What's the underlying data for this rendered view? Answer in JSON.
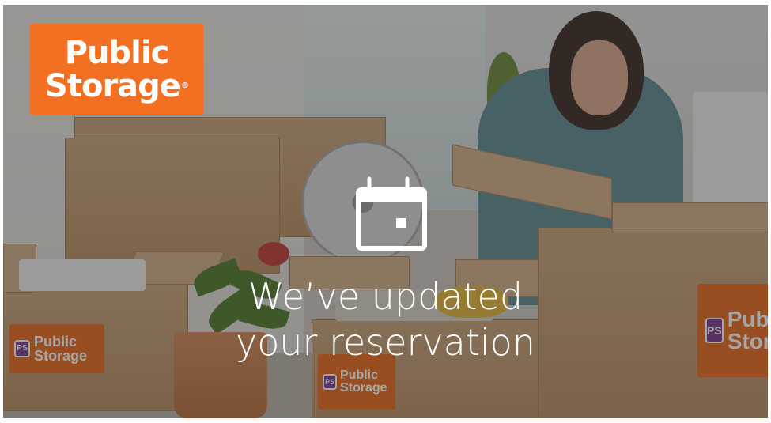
{
  "brand": {
    "logo_line1": "Public",
    "logo_line2": "Storage",
    "logo_reg": "®",
    "box_label_line1": "Public",
    "box_label_line2": "Storage",
    "badge": "PS",
    "color": "#f36f21"
  },
  "message": {
    "icon": "calendar-icon",
    "line1": "We’ve updated",
    "line2": "your reservation"
  }
}
